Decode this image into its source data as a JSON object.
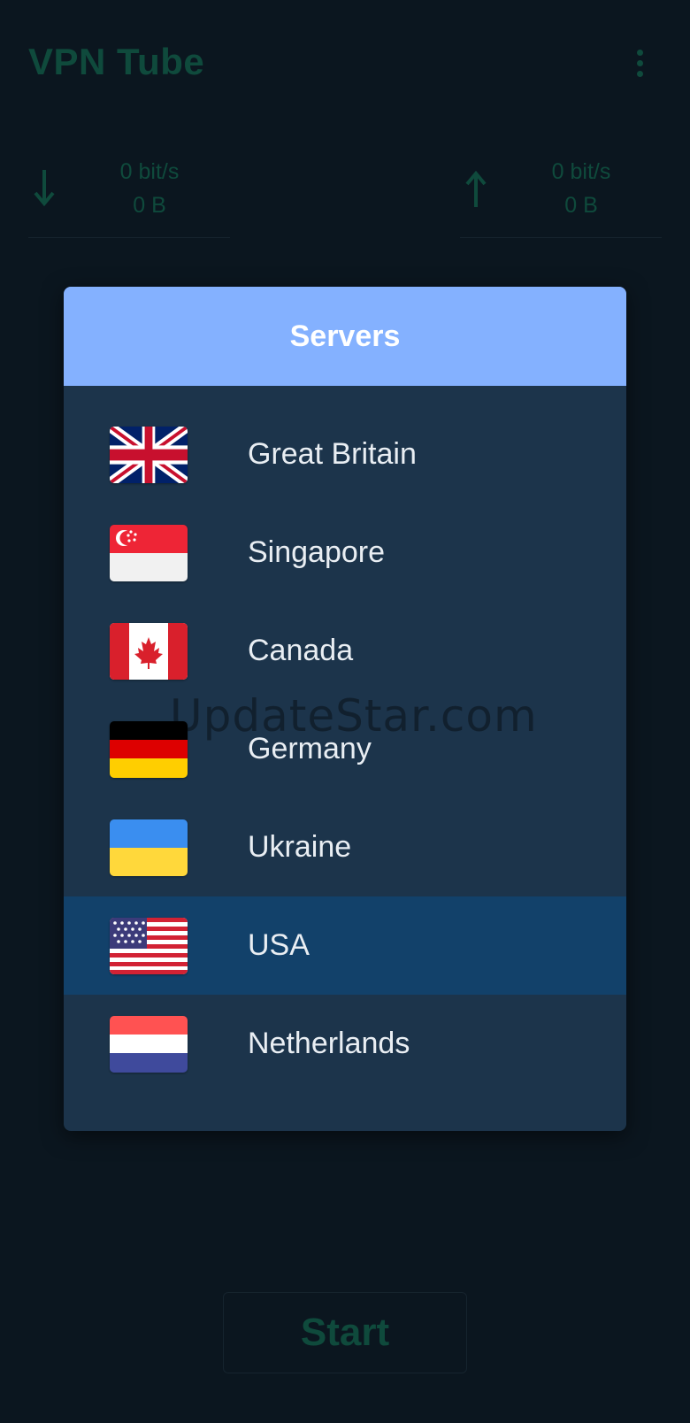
{
  "app": {
    "title": "VPN Tube",
    "menu_icon": "more-vert-icon"
  },
  "stats": {
    "download": {
      "icon": "arrow-down-icon",
      "rate": "0 bit/s",
      "bytes": "0 B"
    },
    "upload": {
      "icon": "arrow-up-icon",
      "rate": "0 bit/s",
      "bytes": "0 B"
    }
  },
  "start_button": {
    "label": "Start"
  },
  "dialog": {
    "title": "Servers",
    "servers": [
      {
        "name": "Great Britain",
        "flag": "flag-gb-icon",
        "selected": false
      },
      {
        "name": "Singapore",
        "flag": "flag-sg-icon",
        "selected": false
      },
      {
        "name": "Canada",
        "flag": "flag-ca-icon",
        "selected": false
      },
      {
        "name": "Germany",
        "flag": "flag-de-icon",
        "selected": false
      },
      {
        "name": "Ukraine",
        "flag": "flag-ua-icon",
        "selected": false
      },
      {
        "name": "USA",
        "flag": "flag-us-icon",
        "selected": true
      },
      {
        "name": "Netherlands",
        "flag": "flag-nl-icon",
        "selected": false
      }
    ]
  },
  "watermark": {
    "text": "UpdateStar.com"
  },
  "colors": {
    "background": "#0b161f",
    "dimmed_accent": "#0f4a3c",
    "dialog_header": "#84b1ff",
    "dialog_body": "#1c344b",
    "selected_row": "#12416a"
  }
}
